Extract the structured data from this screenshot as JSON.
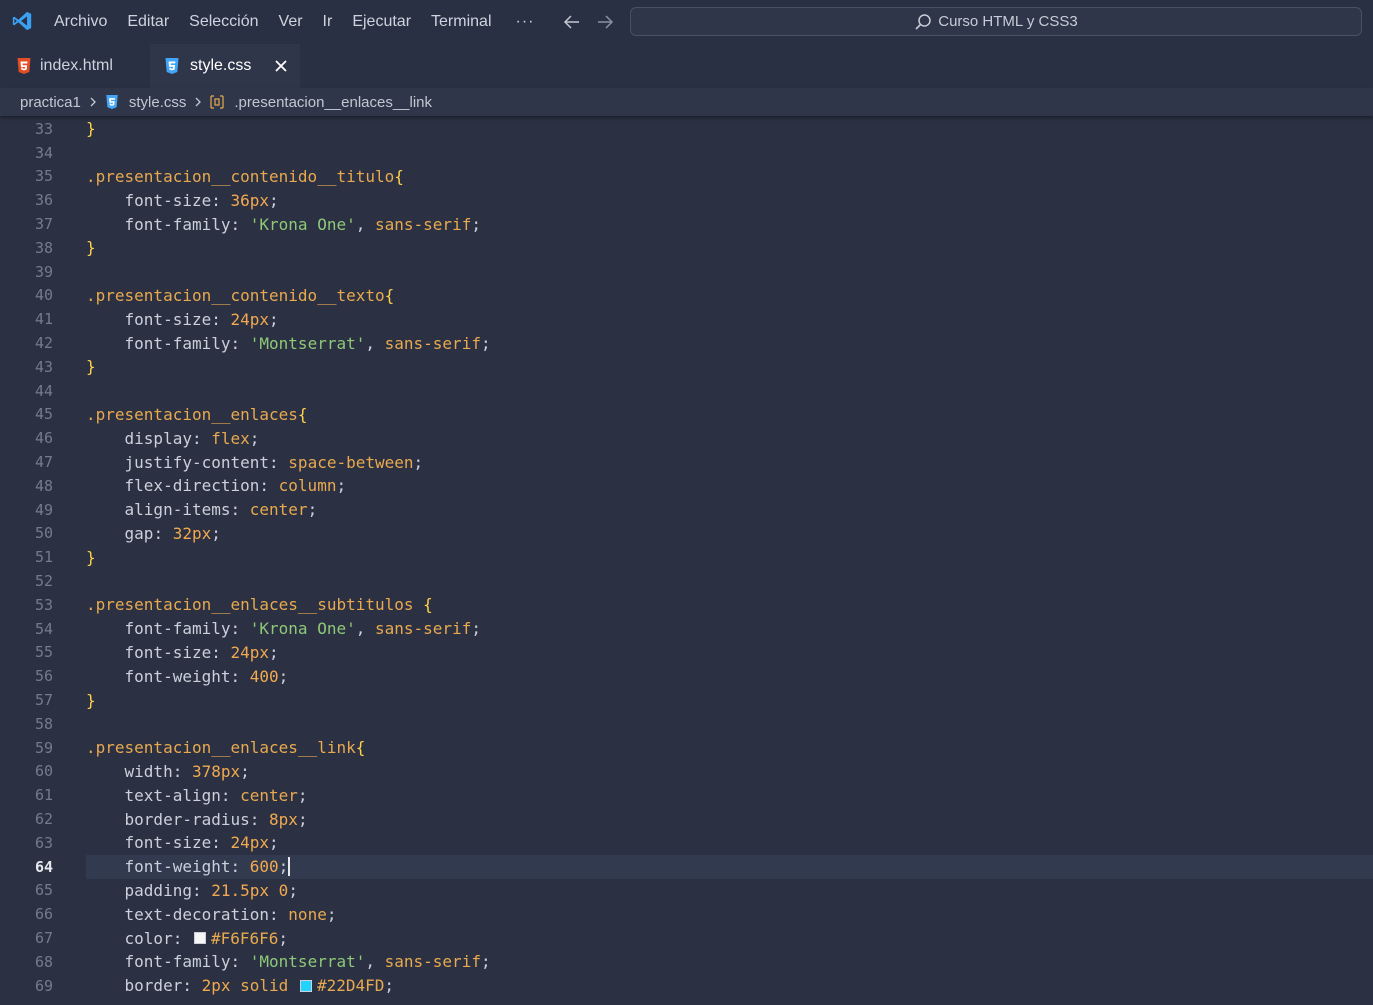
{
  "titlebar": {
    "menu": [
      "Archivo",
      "Editar",
      "Selección",
      "Ver",
      "Ir",
      "Ejecutar",
      "Terminal"
    ],
    "more": "···",
    "search": "Curso HTML y CSS3"
  },
  "tabs": [
    {
      "label": "index.html",
      "icon": "html5-icon"
    },
    {
      "label": "style.css",
      "icon": "css3-icon",
      "active": true
    }
  ],
  "breadcrumb": {
    "folder": "practica1",
    "file": "style.css",
    "symbol": ".presentacion__enlaces__link"
  },
  "editor": {
    "current_line": 64,
    "lines": [
      {
        "n": "33",
        "tokens": [
          [
            "brace",
            "}"
          ]
        ]
      },
      {
        "n": "34",
        "tokens": []
      },
      {
        "n": "35",
        "tokens": [
          [
            "selector",
            ".presentacion__contenido__titulo"
          ],
          [
            "brace",
            "{"
          ]
        ]
      },
      {
        "n": "36",
        "tokens": [
          [
            "prop",
            "    font-size"
          ],
          [
            "punc",
            ": "
          ],
          [
            "num",
            "36px"
          ],
          [
            "punc",
            ";"
          ]
        ]
      },
      {
        "n": "37",
        "tokens": [
          [
            "prop",
            "    font-family"
          ],
          [
            "punc",
            ": "
          ],
          [
            "str",
            "'Krona One'"
          ],
          [
            "punc",
            ", "
          ],
          [
            "val",
            "sans-serif"
          ],
          [
            "punc",
            ";"
          ]
        ]
      },
      {
        "n": "38",
        "tokens": [
          [
            "brace",
            "}"
          ]
        ]
      },
      {
        "n": "39",
        "tokens": []
      },
      {
        "n": "40",
        "tokens": [
          [
            "selector",
            ".presentacion__contenido__texto"
          ],
          [
            "brace",
            "{"
          ]
        ]
      },
      {
        "n": "41",
        "tokens": [
          [
            "prop",
            "    font-size"
          ],
          [
            "punc",
            ": "
          ],
          [
            "num",
            "24px"
          ],
          [
            "punc",
            ";"
          ]
        ]
      },
      {
        "n": "42",
        "tokens": [
          [
            "prop",
            "    font-family"
          ],
          [
            "punc",
            ": "
          ],
          [
            "str",
            "'Montserrat'"
          ],
          [
            "punc",
            ", "
          ],
          [
            "val",
            "sans-serif"
          ],
          [
            "punc",
            ";"
          ]
        ]
      },
      {
        "n": "43",
        "tokens": [
          [
            "brace",
            "}"
          ]
        ]
      },
      {
        "n": "44",
        "tokens": []
      },
      {
        "n": "45",
        "tokens": [
          [
            "selector",
            ".presentacion__enlaces"
          ],
          [
            "brace",
            "{"
          ]
        ]
      },
      {
        "n": "46",
        "tokens": [
          [
            "prop",
            "    display"
          ],
          [
            "punc",
            ": "
          ],
          [
            "val",
            "flex"
          ],
          [
            "punc",
            ";"
          ]
        ]
      },
      {
        "n": "47",
        "tokens": [
          [
            "prop",
            "    justify-content"
          ],
          [
            "punc",
            ": "
          ],
          [
            "val",
            "space-between"
          ],
          [
            "punc",
            ";"
          ]
        ]
      },
      {
        "n": "48",
        "tokens": [
          [
            "prop",
            "    flex-direction"
          ],
          [
            "punc",
            ": "
          ],
          [
            "val",
            "column"
          ],
          [
            "punc",
            ";"
          ]
        ]
      },
      {
        "n": "49",
        "tokens": [
          [
            "prop",
            "    align-items"
          ],
          [
            "punc",
            ": "
          ],
          [
            "val",
            "center"
          ],
          [
            "punc",
            ";"
          ]
        ]
      },
      {
        "n": "50",
        "tokens": [
          [
            "prop",
            "    gap"
          ],
          [
            "punc",
            ": "
          ],
          [
            "num",
            "32px"
          ],
          [
            "punc",
            ";"
          ]
        ]
      },
      {
        "n": "51",
        "tokens": [
          [
            "brace",
            "}"
          ]
        ]
      },
      {
        "n": "52",
        "tokens": []
      },
      {
        "n": "53",
        "tokens": [
          [
            "selector",
            ".presentacion__enlaces__subtitulos "
          ],
          [
            "brace",
            "{"
          ]
        ]
      },
      {
        "n": "54",
        "tokens": [
          [
            "prop",
            "    font-family"
          ],
          [
            "punc",
            ": "
          ],
          [
            "str",
            "'Krona One'"
          ],
          [
            "punc",
            ", "
          ],
          [
            "val",
            "sans-serif"
          ],
          [
            "punc",
            ";"
          ]
        ]
      },
      {
        "n": "55",
        "tokens": [
          [
            "prop",
            "    font-size"
          ],
          [
            "punc",
            ": "
          ],
          [
            "num",
            "24px"
          ],
          [
            "punc",
            ";"
          ]
        ]
      },
      {
        "n": "56",
        "tokens": [
          [
            "prop",
            "    font-weight"
          ],
          [
            "punc",
            ": "
          ],
          [
            "num",
            "400"
          ],
          [
            "punc",
            ";"
          ]
        ]
      },
      {
        "n": "57",
        "tokens": [
          [
            "brace",
            "}"
          ]
        ]
      },
      {
        "n": "58",
        "tokens": []
      },
      {
        "n": "59",
        "tokens": [
          [
            "selector",
            ".presentacion__enlaces__link"
          ],
          [
            "brace",
            "{"
          ]
        ]
      },
      {
        "n": "60",
        "tokens": [
          [
            "prop",
            "    width"
          ],
          [
            "punc",
            ": "
          ],
          [
            "num",
            "378px"
          ],
          [
            "punc",
            ";"
          ]
        ]
      },
      {
        "n": "61",
        "tokens": [
          [
            "prop",
            "    text-align"
          ],
          [
            "punc",
            ": "
          ],
          [
            "val",
            "center"
          ],
          [
            "punc",
            ";"
          ]
        ]
      },
      {
        "n": "62",
        "tokens": [
          [
            "prop",
            "    border-radius"
          ],
          [
            "punc",
            ": "
          ],
          [
            "num",
            "8px"
          ],
          [
            "punc",
            ";"
          ]
        ]
      },
      {
        "n": "63",
        "tokens": [
          [
            "prop",
            "    font-size"
          ],
          [
            "punc",
            ": "
          ],
          [
            "num",
            "24px"
          ],
          [
            "punc",
            ";"
          ]
        ]
      },
      {
        "n": "64",
        "tokens": [
          [
            "prop",
            "    font-weight"
          ],
          [
            "punc",
            ": "
          ],
          [
            "num",
            "600"
          ],
          [
            "punc",
            ";"
          ],
          [
            "cursor",
            ""
          ]
        ]
      },
      {
        "n": "65",
        "tokens": [
          [
            "prop",
            "    padding"
          ],
          [
            "punc",
            ": "
          ],
          [
            "num",
            "21.5px"
          ],
          [
            "punc",
            " "
          ],
          [
            "num",
            "0"
          ],
          [
            "punc",
            ";"
          ]
        ]
      },
      {
        "n": "66",
        "tokens": [
          [
            "prop",
            "    text-decoration"
          ],
          [
            "punc",
            ": "
          ],
          [
            "val",
            "none"
          ],
          [
            "punc",
            ";"
          ]
        ]
      },
      {
        "n": "67",
        "tokens": [
          [
            "prop",
            "    color"
          ],
          [
            "punc",
            ": "
          ],
          [
            "swatch",
            "#F6F6F6"
          ],
          [
            "val",
            "#F6F6F6"
          ],
          [
            "punc",
            ";"
          ]
        ]
      },
      {
        "n": "68",
        "tokens": [
          [
            "prop",
            "    font-family"
          ],
          [
            "punc",
            ": "
          ],
          [
            "str",
            "'Montserrat'"
          ],
          [
            "punc",
            ", "
          ],
          [
            "val",
            "sans-serif"
          ],
          [
            "punc",
            ";"
          ]
        ]
      },
      {
        "n": "69",
        "tokens": [
          [
            "prop",
            "    border"
          ],
          [
            "punc",
            ": "
          ],
          [
            "num",
            "2px"
          ],
          [
            "punc",
            " "
          ],
          [
            "val",
            "solid"
          ],
          [
            "punc",
            " "
          ],
          [
            "swatch",
            "#22D4FD"
          ],
          [
            "val",
            "#22D4FD"
          ],
          [
            "punc",
            ";"
          ]
        ]
      }
    ]
  },
  "colors": {
    "background": "#2b3142",
    "titlebar": "#293044",
    "selector": "#e8a94f",
    "brace": "#ffd24a",
    "string": "#8ec878",
    "number": "#f2a950",
    "accent": "#22D4FD"
  }
}
